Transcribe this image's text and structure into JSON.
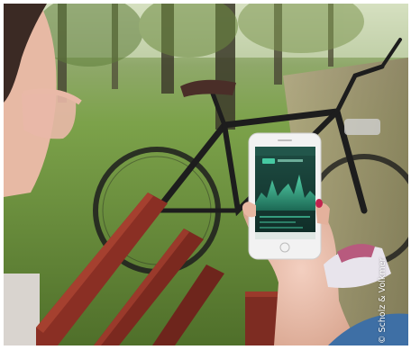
{
  "photo": {
    "credit": "© Scholz & Volkmer",
    "scene": {
      "grass_color": "#6f9a3a",
      "bench_color": "#8a2f24",
      "phone_body_color": "#f2f2f2",
      "screen_color": "#163a33",
      "screen_accent_color": "#46c9a2"
    }
  }
}
